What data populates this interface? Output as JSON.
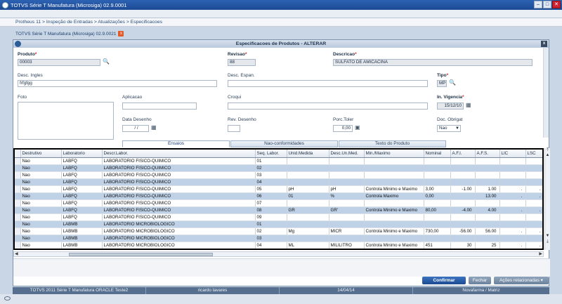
{
  "window": {
    "title": "TOTVS Série T Manufatura (Microsiga) 02.9.0001",
    "controls": [
      "–",
      "□",
      "✕"
    ]
  },
  "breadcrumb": "Protheus 11 > Inspeção de Entradas > Atualizações > Especificacoes",
  "env_tab": {
    "label": "TOTVS Série T Manufatura (Microsiga) 02.9.0021",
    "close": "x"
  },
  "dialog": {
    "title": "Especificacoes de Produtos - ALTERAR",
    "close": "x",
    "fields": {
      "produto": {
        "label": "Produto",
        "value": "00003"
      },
      "revisao": {
        "label": "Revisao",
        "value": "88"
      },
      "descricao": {
        "label": "Descricao",
        "value": "SULFATO DE AMICACINA"
      },
      "desc_ingles": {
        "label": "Desc. Ingles",
        "value": "frfgfgg"
      },
      "desc_espan": {
        "label": "Desc. Espan.",
        "value": ""
      },
      "tipo": {
        "label": "Tipo",
        "value": "MP"
      },
      "foto": {
        "label": "Foto"
      },
      "aplicacao": {
        "label": "Aplicacao",
        "value": ""
      },
      "croqui": {
        "label": "Croqui",
        "value": ""
      },
      "in_vigencia": {
        "label": "In. Vigencia",
        "value": "15/12/10"
      },
      "data_desenho": {
        "label": "Data Desenho",
        "value": "/ /"
      },
      "rev_desenho": {
        "label": "Rev. Desenho",
        "value": ""
      },
      "porc_toler": {
        "label": "Porc.Toler",
        "value": "0,00"
      },
      "doc_obrigat": {
        "label": "Doc. Obrigat",
        "value": "Nao"
      }
    },
    "tabs": [
      {
        "label": "Ensaios",
        "active": true
      },
      {
        "label": "Nao-conformidades",
        "active": false
      },
      {
        "label": "Texto do Produto",
        "active": false
      }
    ],
    "grid": {
      "columns": [
        "Destrutivo",
        "Laboratorio",
        "Descr.Labor.",
        "Seq. Labor.",
        "Unid.Medida",
        "Desc.Un.Med.",
        "Min./Maximo",
        "Nominal",
        "A.F.I.",
        "A.F.S.",
        "LIC",
        "LSC"
      ],
      "rows": [
        [
          "Nao",
          "LABFQ",
          "LABORATORIO FISICO-QUIMICO",
          "01",
          "",
          "",
          "",
          "",
          "",
          "",
          "",
          ""
        ],
        [
          "Nao",
          "LABFQ",
          "LABORATORIO FISICO-QUIMICO",
          "02",
          "",
          "",
          "",
          "",
          "",
          "",
          "",
          ""
        ],
        [
          "Nao",
          "LABFQ",
          "LABORATORIO FISICO-QUIMICO",
          "03",
          "",
          "",
          "",
          "",
          "",
          "",
          "",
          ""
        ],
        [
          "Nao",
          "LABFQ",
          "LABORATORIO FISICO-QUIMICO",
          "04",
          "",
          "",
          "",
          "",
          "",
          "",
          "",
          ""
        ],
        [
          "Nao",
          "LABFQ",
          "LABORATORIO FISICO-QUIMICO",
          "05",
          "pH",
          "pH",
          "Controla Minimo e Maximo",
          "3,00",
          "-1.00",
          "1.00",
          ".",
          "."
        ],
        [
          "Nao",
          "LABFQ",
          "LABORATORIO FISICO-QUIMICO",
          "06",
          "01",
          "%",
          "Controla Maximo",
          "0,00",
          "",
          "13.00",
          ".",
          "."
        ],
        [
          "Nao",
          "LABFQ",
          "LABORATORIO FISICO-QUIMICO",
          "07",
          "",
          "",
          "",
          "",
          "",
          "",
          "",
          ""
        ],
        [
          "Nao",
          "LABFQ",
          "LABORATORIO FISICO-QUIMICO",
          "08",
          "GR",
          "GR'",
          "Controla Minimo e Maximo",
          "80,00",
          "-4.00",
          "4.00",
          ".",
          "."
        ],
        [
          "Nao",
          "LABFQ",
          "LABORATORIO FISICO-QUIMICO",
          "09",
          "",
          "",
          "",
          "",
          "",
          "",
          "",
          ""
        ],
        [
          "Nao",
          "LABMB",
          "LABORATORIO MICROBIOLOGICO",
          "01",
          "",
          "",
          "",
          "",
          "",
          "",
          "",
          ""
        ],
        [
          "Nao",
          "LABMB",
          "LABORATORIO MICROBIOLOGICO",
          "02",
          "Mg",
          "MICR",
          "Controla Minimo e Maximo",
          "730,00",
          "-56.00",
          "56.00",
          ".",
          "."
        ],
        [
          "Nao",
          "LABMB",
          "LABORATORIO MICROBIOLOGICO",
          "03",
          "",
          "",
          "",
          "",
          "",
          "",
          "",
          ""
        ],
        [
          "Nao",
          "LABMB",
          "LABORATORIO MICROBIOLOGICO",
          "04",
          "ML",
          "MILILITRO",
          "Controla Minimo e Maximo",
          "451",
          "30",
          "25",
          ".",
          "."
        ]
      ]
    },
    "buttons": {
      "confirm": "Confirmar",
      "close": "Fechar",
      "related": "Ações relacionadas"
    }
  },
  "statusbar": [
    "TOTVS 2011 Série T Manufatura ORACLE Teste2",
    "ricardo tavares",
    "14/04/14",
    "Novafarma / Matriz"
  ],
  "colors": {
    "accent": "#1c4b92",
    "row_alt": "#bed1e7",
    "status_bg": "#566f8e"
  }
}
